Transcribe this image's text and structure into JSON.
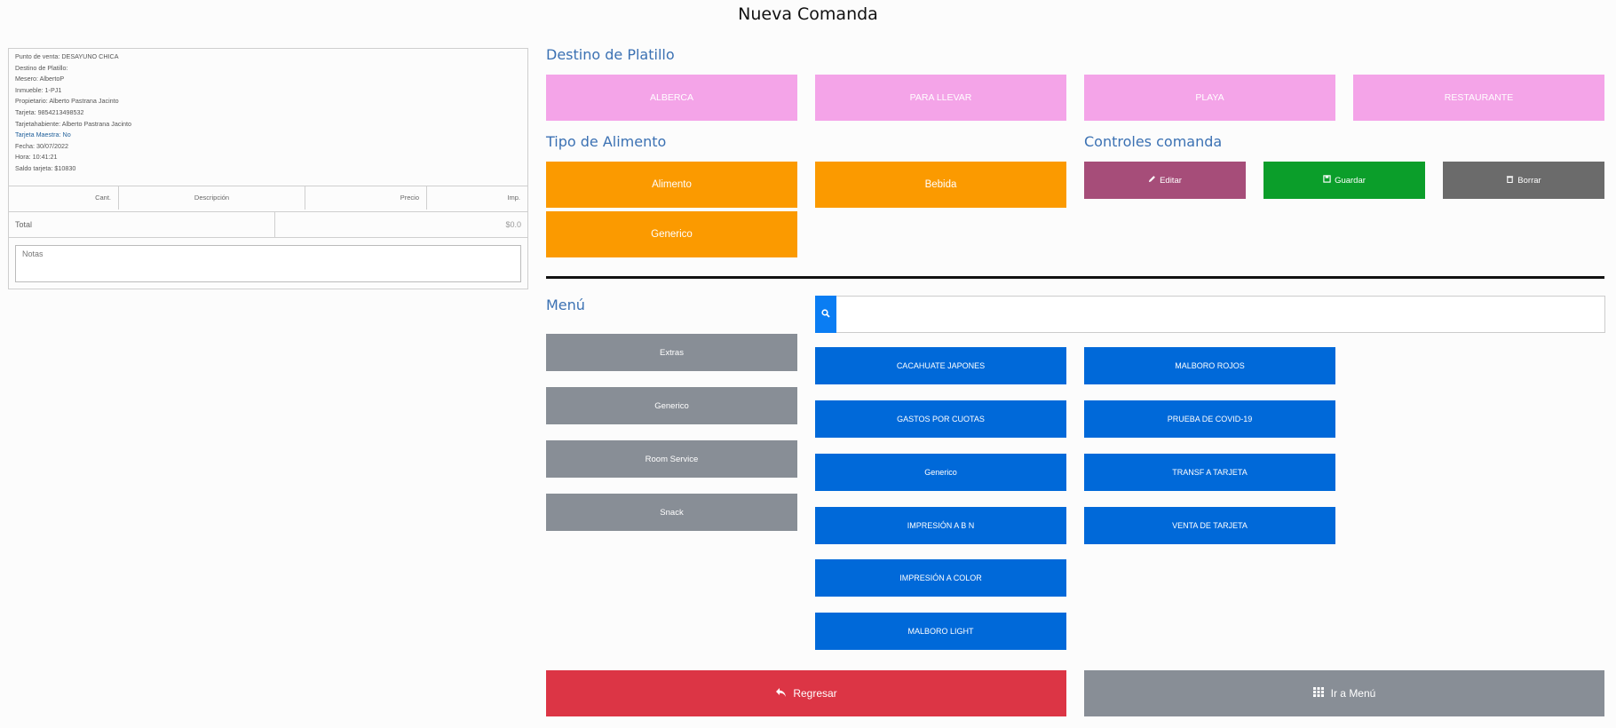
{
  "page": {
    "title": "Nueva Comanda"
  },
  "ticket": {
    "info": {
      "punto_venta": "Punto de venta: DESAYUNO CHICA",
      "destino": "Destino de Platillo:",
      "mesero": "Mesero: AlbertoP",
      "inmueble": "Inmueble: 1-PJ1",
      "propietario": "Propietario: Alberto Pastrana Jacinto",
      "tarjeta": "Tarjeta: 9854213498532",
      "tarjetahabiente": "Tarjetahabiente: Alberto Pastrana Jacinto",
      "tarjeta_maestra": "Tarjeta Maestra: No",
      "fecha": "Fecha: 30/07/2022",
      "hora": "Hora: 10:41:21",
      "saldo": "Saldo tarjeta: $10830"
    },
    "columns": {
      "cant": "Cant.",
      "descripcion": "Descripción",
      "precio": "Precio",
      "imp": "Imp."
    },
    "total_label": "Total",
    "total_value": "$0.0",
    "notes_placeholder": "Notas"
  },
  "destino": {
    "title": "Destino de Platillo",
    "options": [
      "ALBERCA",
      "PARA LLEVAR",
      "PLAYA",
      "RESTAURANTE"
    ]
  },
  "tipo": {
    "title": "Tipo de Alimento",
    "options": [
      "Alimento",
      "Bebida",
      "Generico"
    ]
  },
  "controles": {
    "title": "Controles comanda",
    "editar": "Editar",
    "guardar": "Guardar",
    "borrar": "Borrar"
  },
  "menu": {
    "title": "Menú",
    "categories": [
      "Extras",
      "Generico",
      "Room Service",
      "Snack"
    ],
    "search_placeholder": "",
    "items_col1": [
      "CACAHUATE JAPONES",
      "GASTOS POR CUOTAS",
      "Generico",
      "IMPRESIÓN A B N",
      "IMPRESIÓN A COLOR",
      "MALBORO LIGHT"
    ],
    "items_col2": [
      "MALBORO ROJOS",
      "PRUEBA DE COVID-19",
      "TRANSF A TARJETA",
      "VENTA DE TARJETA"
    ]
  },
  "footer": {
    "regresar": "Regresar",
    "ir_menu": "Ir a Menú"
  },
  "colors": {
    "pink": "#f4a4e8",
    "orange": "#fb9a00",
    "editar": "#a64d79",
    "guardar": "#0b9e2a",
    "borrar": "#6b6b6b",
    "category": "#888e96",
    "item": "#0069d9",
    "regresar": "#dc3545",
    "ir_menu": "#888e96"
  },
  "icons": {
    "editar": "pencil-icon",
    "guardar": "save-icon",
    "borrar": "trash-icon",
    "search": "search-icon",
    "regresar": "reply-arrow-icon",
    "ir_menu": "grid-icon"
  }
}
